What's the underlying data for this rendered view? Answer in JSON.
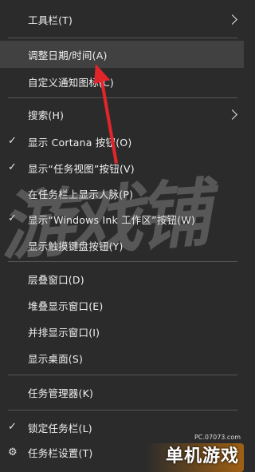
{
  "menu": {
    "items": [
      {
        "label": "工具栏(T)"
      },
      {
        "label": "调整日期/时间(A)"
      },
      {
        "label": "自定义通知图标(C)"
      },
      {
        "label": "搜索(H)"
      },
      {
        "label": "显示 Cortana 按钮(O)"
      },
      {
        "label": "显示“任务视图”按钮(V)"
      },
      {
        "label": "在任务栏上显示人脉(P)"
      },
      {
        "label": "显示“Windows Ink 工作区”按钮(W)"
      },
      {
        "label": "显示触摸键盘按钮(Y)"
      },
      {
        "label": "层叠窗口(D)"
      },
      {
        "label": "堆叠显示窗口(E)"
      },
      {
        "label": "并排显示窗口(I)"
      },
      {
        "label": "显示桌面(S)"
      },
      {
        "label": "任务管理器(K)"
      },
      {
        "label": "锁定任务栏(L)"
      },
      {
        "label": "任务栏设置(T)"
      }
    ],
    "checked": [
      "显示 Cortana 按钮(O)",
      "显示“任务视图”按钮(V)",
      "显示“Windows Ink 工作区”按钮(W)",
      "锁定任务栏(L)"
    ],
    "highlighted": "调整日期/时间(A)",
    "submenu_items": [
      "工具栏(T)",
      "搜索(H)"
    ]
  },
  "watermark": {
    "text": "游戏铺"
  },
  "brand": {
    "url": "PC.07073.com",
    "logo": "单机游戏"
  },
  "colors": {
    "background": "#2b2b2b",
    "highlight": "#414141",
    "separator": "#555555",
    "arrow": "#e0262b"
  },
  "icons": {
    "check": "check-icon",
    "submenu": "chevron-right-icon",
    "settings": "gear-icon"
  }
}
